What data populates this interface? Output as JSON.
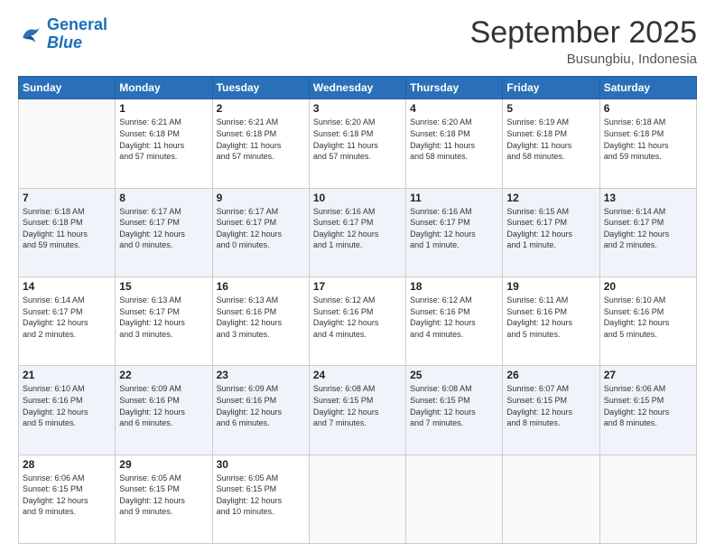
{
  "header": {
    "logo_general": "General",
    "logo_blue": "Blue",
    "month": "September 2025",
    "location": "Busungbiu, Indonesia"
  },
  "days_of_week": [
    "Sunday",
    "Monday",
    "Tuesday",
    "Wednesday",
    "Thursday",
    "Friday",
    "Saturday"
  ],
  "weeks": [
    [
      {
        "day": "",
        "info": ""
      },
      {
        "day": "1",
        "info": "Sunrise: 6:21 AM\nSunset: 6:18 PM\nDaylight: 11 hours\nand 57 minutes."
      },
      {
        "day": "2",
        "info": "Sunrise: 6:21 AM\nSunset: 6:18 PM\nDaylight: 11 hours\nand 57 minutes."
      },
      {
        "day": "3",
        "info": "Sunrise: 6:20 AM\nSunset: 6:18 PM\nDaylight: 11 hours\nand 57 minutes."
      },
      {
        "day": "4",
        "info": "Sunrise: 6:20 AM\nSunset: 6:18 PM\nDaylight: 11 hours\nand 58 minutes."
      },
      {
        "day": "5",
        "info": "Sunrise: 6:19 AM\nSunset: 6:18 PM\nDaylight: 11 hours\nand 58 minutes."
      },
      {
        "day": "6",
        "info": "Sunrise: 6:18 AM\nSunset: 6:18 PM\nDaylight: 11 hours\nand 59 minutes."
      }
    ],
    [
      {
        "day": "7",
        "info": "Sunrise: 6:18 AM\nSunset: 6:18 PM\nDaylight: 11 hours\nand 59 minutes."
      },
      {
        "day": "8",
        "info": "Sunrise: 6:17 AM\nSunset: 6:17 PM\nDaylight: 12 hours\nand 0 minutes."
      },
      {
        "day": "9",
        "info": "Sunrise: 6:17 AM\nSunset: 6:17 PM\nDaylight: 12 hours\nand 0 minutes."
      },
      {
        "day": "10",
        "info": "Sunrise: 6:16 AM\nSunset: 6:17 PM\nDaylight: 12 hours\nand 1 minute."
      },
      {
        "day": "11",
        "info": "Sunrise: 6:16 AM\nSunset: 6:17 PM\nDaylight: 12 hours\nand 1 minute."
      },
      {
        "day": "12",
        "info": "Sunrise: 6:15 AM\nSunset: 6:17 PM\nDaylight: 12 hours\nand 1 minute."
      },
      {
        "day": "13",
        "info": "Sunrise: 6:14 AM\nSunset: 6:17 PM\nDaylight: 12 hours\nand 2 minutes."
      }
    ],
    [
      {
        "day": "14",
        "info": "Sunrise: 6:14 AM\nSunset: 6:17 PM\nDaylight: 12 hours\nand 2 minutes."
      },
      {
        "day": "15",
        "info": "Sunrise: 6:13 AM\nSunset: 6:17 PM\nDaylight: 12 hours\nand 3 minutes."
      },
      {
        "day": "16",
        "info": "Sunrise: 6:13 AM\nSunset: 6:16 PM\nDaylight: 12 hours\nand 3 minutes."
      },
      {
        "day": "17",
        "info": "Sunrise: 6:12 AM\nSunset: 6:16 PM\nDaylight: 12 hours\nand 4 minutes."
      },
      {
        "day": "18",
        "info": "Sunrise: 6:12 AM\nSunset: 6:16 PM\nDaylight: 12 hours\nand 4 minutes."
      },
      {
        "day": "19",
        "info": "Sunrise: 6:11 AM\nSunset: 6:16 PM\nDaylight: 12 hours\nand 5 minutes."
      },
      {
        "day": "20",
        "info": "Sunrise: 6:10 AM\nSunset: 6:16 PM\nDaylight: 12 hours\nand 5 minutes."
      }
    ],
    [
      {
        "day": "21",
        "info": "Sunrise: 6:10 AM\nSunset: 6:16 PM\nDaylight: 12 hours\nand 5 minutes."
      },
      {
        "day": "22",
        "info": "Sunrise: 6:09 AM\nSunset: 6:16 PM\nDaylight: 12 hours\nand 6 minutes."
      },
      {
        "day": "23",
        "info": "Sunrise: 6:09 AM\nSunset: 6:16 PM\nDaylight: 12 hours\nand 6 minutes."
      },
      {
        "day": "24",
        "info": "Sunrise: 6:08 AM\nSunset: 6:15 PM\nDaylight: 12 hours\nand 7 minutes."
      },
      {
        "day": "25",
        "info": "Sunrise: 6:08 AM\nSunset: 6:15 PM\nDaylight: 12 hours\nand 7 minutes."
      },
      {
        "day": "26",
        "info": "Sunrise: 6:07 AM\nSunset: 6:15 PM\nDaylight: 12 hours\nand 8 minutes."
      },
      {
        "day": "27",
        "info": "Sunrise: 6:06 AM\nSunset: 6:15 PM\nDaylight: 12 hours\nand 8 minutes."
      }
    ],
    [
      {
        "day": "28",
        "info": "Sunrise: 6:06 AM\nSunset: 6:15 PM\nDaylight: 12 hours\nand 9 minutes."
      },
      {
        "day": "29",
        "info": "Sunrise: 6:05 AM\nSunset: 6:15 PM\nDaylight: 12 hours\nand 9 minutes."
      },
      {
        "day": "30",
        "info": "Sunrise: 6:05 AM\nSunset: 6:15 PM\nDaylight: 12 hours\nand 10 minutes."
      },
      {
        "day": "",
        "info": ""
      },
      {
        "day": "",
        "info": ""
      },
      {
        "day": "",
        "info": ""
      },
      {
        "day": "",
        "info": ""
      }
    ]
  ]
}
